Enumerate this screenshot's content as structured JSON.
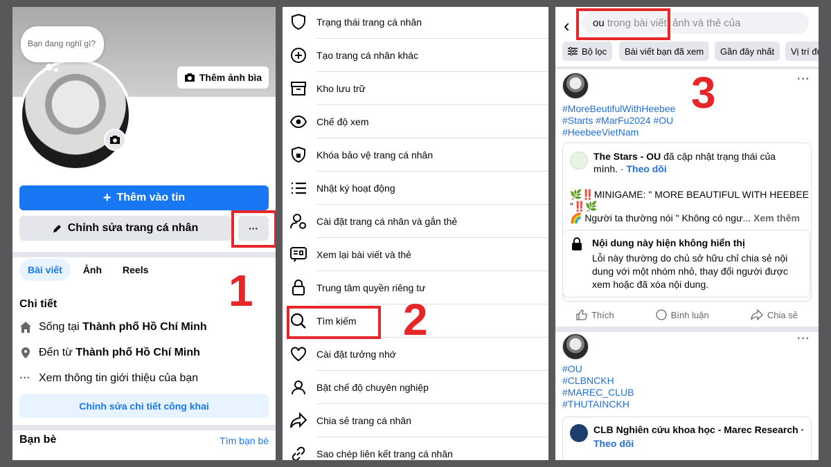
{
  "panel1": {
    "bubble_text": "Bạn đang nghĩ gì?",
    "cover_button": "Thêm ảnh bìa",
    "add_story": "Thêm vào tin",
    "edit_profile": "Chỉnh sửa trang cá nhân",
    "more_button": "···",
    "tabs": [
      "Bài viết",
      "Ảnh",
      "Reels"
    ],
    "details_title": "Chi tiết",
    "detail_rows": [
      {
        "prefix": "Sống tại ",
        "bold": "Thành phố Hồ Chí Minh"
      },
      {
        "prefix": "Đến từ ",
        "bold": "Thành phố Hồ Chí Minh"
      },
      {
        "prefix": "Xem thông tin giới thiệu của bạn",
        "bold": ""
      }
    ],
    "edit_public": "Chỉnh sửa chi tiết công khai",
    "friends_title": "Bạn bè",
    "find_friends": "Tìm bạn bè",
    "step_number": "1"
  },
  "panel2": {
    "menu": [
      {
        "label": "Trạng thái trang cá nhân",
        "icon": "shield-icon"
      },
      {
        "label": "Tạo trang cá nhân khác",
        "icon": "plus-circle-icon"
      },
      {
        "label": "Kho lưu trữ",
        "icon": "archive-icon"
      },
      {
        "label": "Chế độ xem",
        "icon": "eye-icon"
      },
      {
        "label": "Khóa bảo vệ trang cá nhân",
        "icon": "shield-lock-icon"
      },
      {
        "label": "Nhật ký hoạt động",
        "icon": "list-icon"
      },
      {
        "label": "Cài đặt trang cá nhân và gắn thẻ",
        "icon": "user-gear-icon"
      },
      {
        "label": "Xem lại bài viết và thẻ",
        "icon": "review-icon"
      },
      {
        "label": "Trung tâm quyền riêng tư",
        "icon": "lock-icon"
      },
      {
        "label": "Tìm kiếm",
        "icon": "search-icon"
      },
      {
        "label": "Cài đặt tưởng nhớ",
        "icon": "heart-icon"
      },
      {
        "label": "Bật chế độ chuyên nghiệp",
        "icon": "professional-icon"
      },
      {
        "label": "Chia sẻ trang cá nhân",
        "icon": "share-icon"
      },
      {
        "label": "Sao chép liên kết trang cá nhân",
        "icon": "link-icon"
      }
    ],
    "step_number": "2"
  },
  "panel3": {
    "search_value": "ou",
    "search_placeholder": "trong bài viết, ảnh và thẻ của",
    "chips": [
      "Bộ lọc",
      "Bài viết bạn đã xem",
      "Gần đây nhất",
      "Vị trí đư"
    ],
    "step_number": "3",
    "post1": {
      "hashtags": [
        "#MoreBeutifulWithHeebee",
        "#Starts #MarFu2024 #OU",
        "#HeebeeVietNam"
      ],
      "shared_author": "The Stars - OU",
      "shared_action": " đã cập nhật trạng thái của",
      "shared_action2": "mình. · ",
      "follow": "Theo dõi",
      "line1": "🌿‼️MINIGAME: \" MORE BEAUTIFUL WITH HEEBEE",
      "line2": "\"‼️🌿",
      "line3": "🌈 Người ta thường nói \" Không có ngư...",
      "see_more": " Xem thêm",
      "lock_title": "Nội dung này hiện không hiển thị",
      "lock_line1": "Lỗi này thường do chủ sở hữu chỉ chia sẻ nội",
      "lock_line2": "dung với một nhóm nhỏ, thay đổi người được",
      "lock_line3": "xem hoặc đã xóa nội dung.",
      "like": "Thích",
      "comment": "Bình luận",
      "share": "Chia sẻ"
    },
    "post2": {
      "hashtags": [
        "#OU",
        "#CLBNCKH",
        "#MAREC_CLUB",
        "#THUTAINCKH"
      ],
      "shared_author": "CLB Nghiên cứu khoa học - Marec Research ·",
      "follow": "Theo dõi"
    }
  },
  "colors": {
    "accent": "#1877f2",
    "highlight": "#e8262a",
    "hashtag": "#216fdb"
  }
}
